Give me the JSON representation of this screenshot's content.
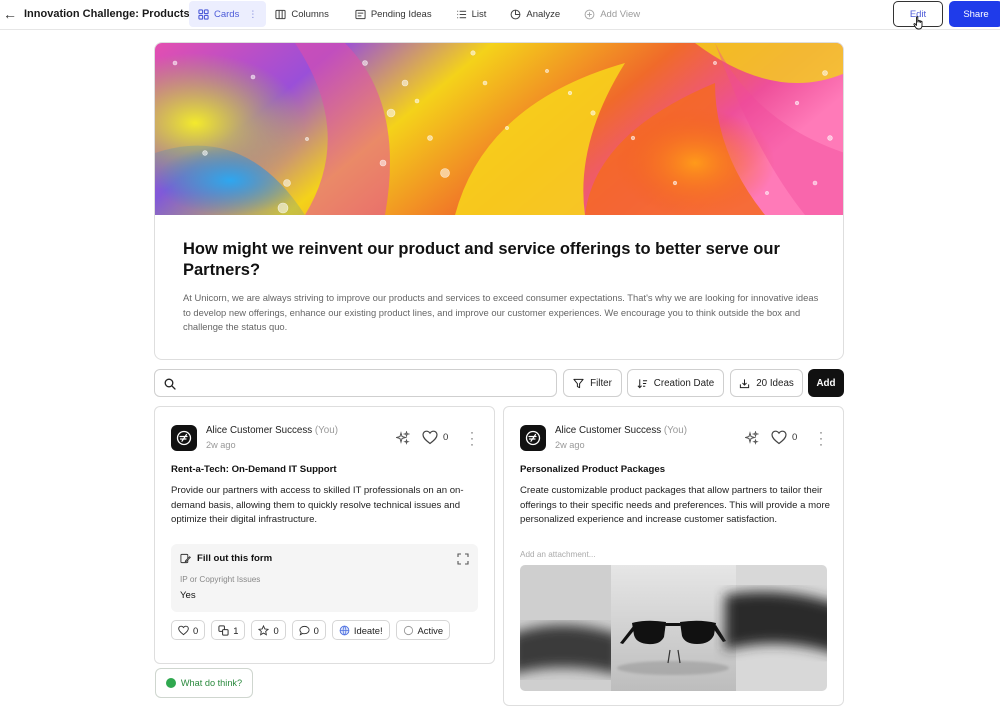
{
  "header": {
    "back_label": "←",
    "board_title": "Innovation Challenge: Products...",
    "views": [
      {
        "label": "Cards",
        "active": true
      },
      {
        "label": "Columns"
      },
      {
        "label": "Pending Ideas"
      },
      {
        "label": "List"
      },
      {
        "label": "Analyze"
      },
      {
        "label": "Add View"
      }
    ],
    "edit_label": "Edit",
    "share_label": "Share"
  },
  "hero": {
    "title": "How might we reinvent our product and service offerings to better serve our Partners?",
    "description": "At Unicorn, we are always striving to improve our products and services to exceed consumer expectations. That's why we are looking for innovative ideas to develop new offerings, enhance our existing product lines, and improve our customer experiences. We encourage you to think outside the box and challenge the status quo."
  },
  "toolbar": {
    "search_placeholder": "",
    "filter_label": "Filter",
    "sort_label": "Creation Date",
    "ideas_label": "20 Ideas",
    "add_label": "Add"
  },
  "ideas": [
    {
      "author": "Alice Customer Success",
      "you": "(You)",
      "time": "2w ago",
      "likes": "0",
      "title": "Rent-a-Tech: On-Demand IT Support",
      "body": "Provide our partners with access to skilled IT professionals on an on-demand basis, allowing them to quickly resolve technical issues and optimize their digital infrastructure.",
      "form": {
        "heading": "Fill out this form",
        "field_label": "IP or Copyright Issues",
        "field_value": "Yes"
      },
      "chips": {
        "likes": "0",
        "builds": "1",
        "stars": "0",
        "comments": "0",
        "ideate": "Ideate!",
        "status": "Active"
      }
    },
    {
      "author": "Alice Customer Success",
      "you": "(You)",
      "time": "2w ago",
      "likes": "0",
      "title": "Personalized Product Packages",
      "body": "Create customizable product packages that allow partners to tailor their offerings to their specific needs and preferences. This will provide a more personalized experience and increase customer satisfaction.",
      "attachment_label": "Add an attachment..."
    }
  ],
  "feedback": {
    "label": "What do think?"
  },
  "colors": {
    "accent": "#4d5bd8",
    "share": "#1f3bea",
    "active_tab_bg": "#eceefe",
    "feedback": "#2b8a3e"
  }
}
